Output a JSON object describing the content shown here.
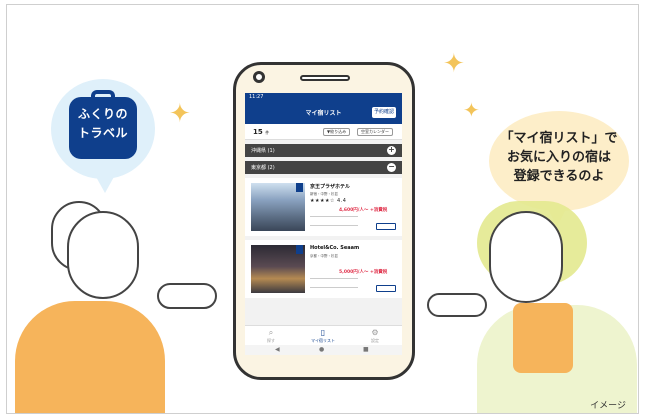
{
  "logo": {
    "line1": "ふくりの",
    "line2": "トラベル"
  },
  "speech": {
    "line1": "「マイ宿リスト」で",
    "line2": "お気に入りの宿は",
    "line3": "登録できるのよ"
  },
  "caption": "イメージ",
  "app": {
    "status_time": "11:27",
    "title": "マイ宿リスト",
    "header_button": "予約確認",
    "count_value": "15",
    "count_unit": "件",
    "filter_button": "▼絞り込み",
    "calendar_button": "空室カレンダー",
    "regions": [
      {
        "label": "沖縄県 (1)",
        "toggle": "+"
      },
      {
        "label": "東京都 (2)",
        "toggle": "−"
      }
    ],
    "hotels": [
      {
        "name": "京王プラザホテル",
        "location": "新宿・中野・杉並",
        "stars": "★★★★☆ 4.4",
        "price": "4,600円/人〜 +消費税"
      },
      {
        "name": "Hotel&Co. Seaam",
        "location": "京都・中野・杉並",
        "stars": "",
        "price": "5,000円/人〜 +消費税"
      }
    ],
    "nav": [
      {
        "icon": "search-icon",
        "label": "探す"
      },
      {
        "icon": "bookmark-icon",
        "label": "マイ宿リスト"
      },
      {
        "icon": "gear-icon",
        "label": "設定"
      }
    ],
    "sys_nav": {
      "back": "◀",
      "home": "●",
      "recent": "■"
    }
  }
}
